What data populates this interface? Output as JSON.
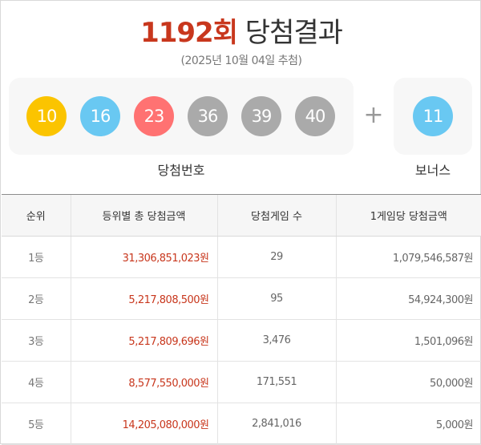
{
  "header": {
    "round": "1192회",
    "title": "당첨결과",
    "date": "(2025년 10월 04일 추첨)"
  },
  "numbers": {
    "main": [
      {
        "value": "10",
        "color": "#fbc400"
      },
      {
        "value": "16",
        "color": "#69c8f2"
      },
      {
        "value": "23",
        "color": "#ff7272"
      },
      {
        "value": "36",
        "color": "#aaaaaa"
      },
      {
        "value": "39",
        "color": "#aaaaaa"
      },
      {
        "value": "40",
        "color": "#aaaaaa"
      }
    ],
    "plus": "+",
    "bonus": {
      "value": "11",
      "color": "#69c8f2"
    },
    "main_label": "당첨번호",
    "bonus_label": "보너스"
  },
  "table": {
    "headers": [
      "순위",
      "등위별 총 당첨금액",
      "당첨게임 수",
      "1게임당 당첨금액"
    ],
    "rows": [
      [
        "1등",
        "31,306,851,023원",
        "29",
        "1,079,546,587원"
      ],
      [
        "2등",
        "5,217,808,500원",
        "95",
        "54,924,300원"
      ],
      [
        "3등",
        "5,217,809,696원",
        "3,476",
        "1,501,096원"
      ],
      [
        "4등",
        "8,577,550,000원",
        "171,551",
        "50,000원"
      ],
      [
        "5등",
        "14,205,080,000원",
        "2,841,016",
        "5,000원"
      ]
    ]
  }
}
